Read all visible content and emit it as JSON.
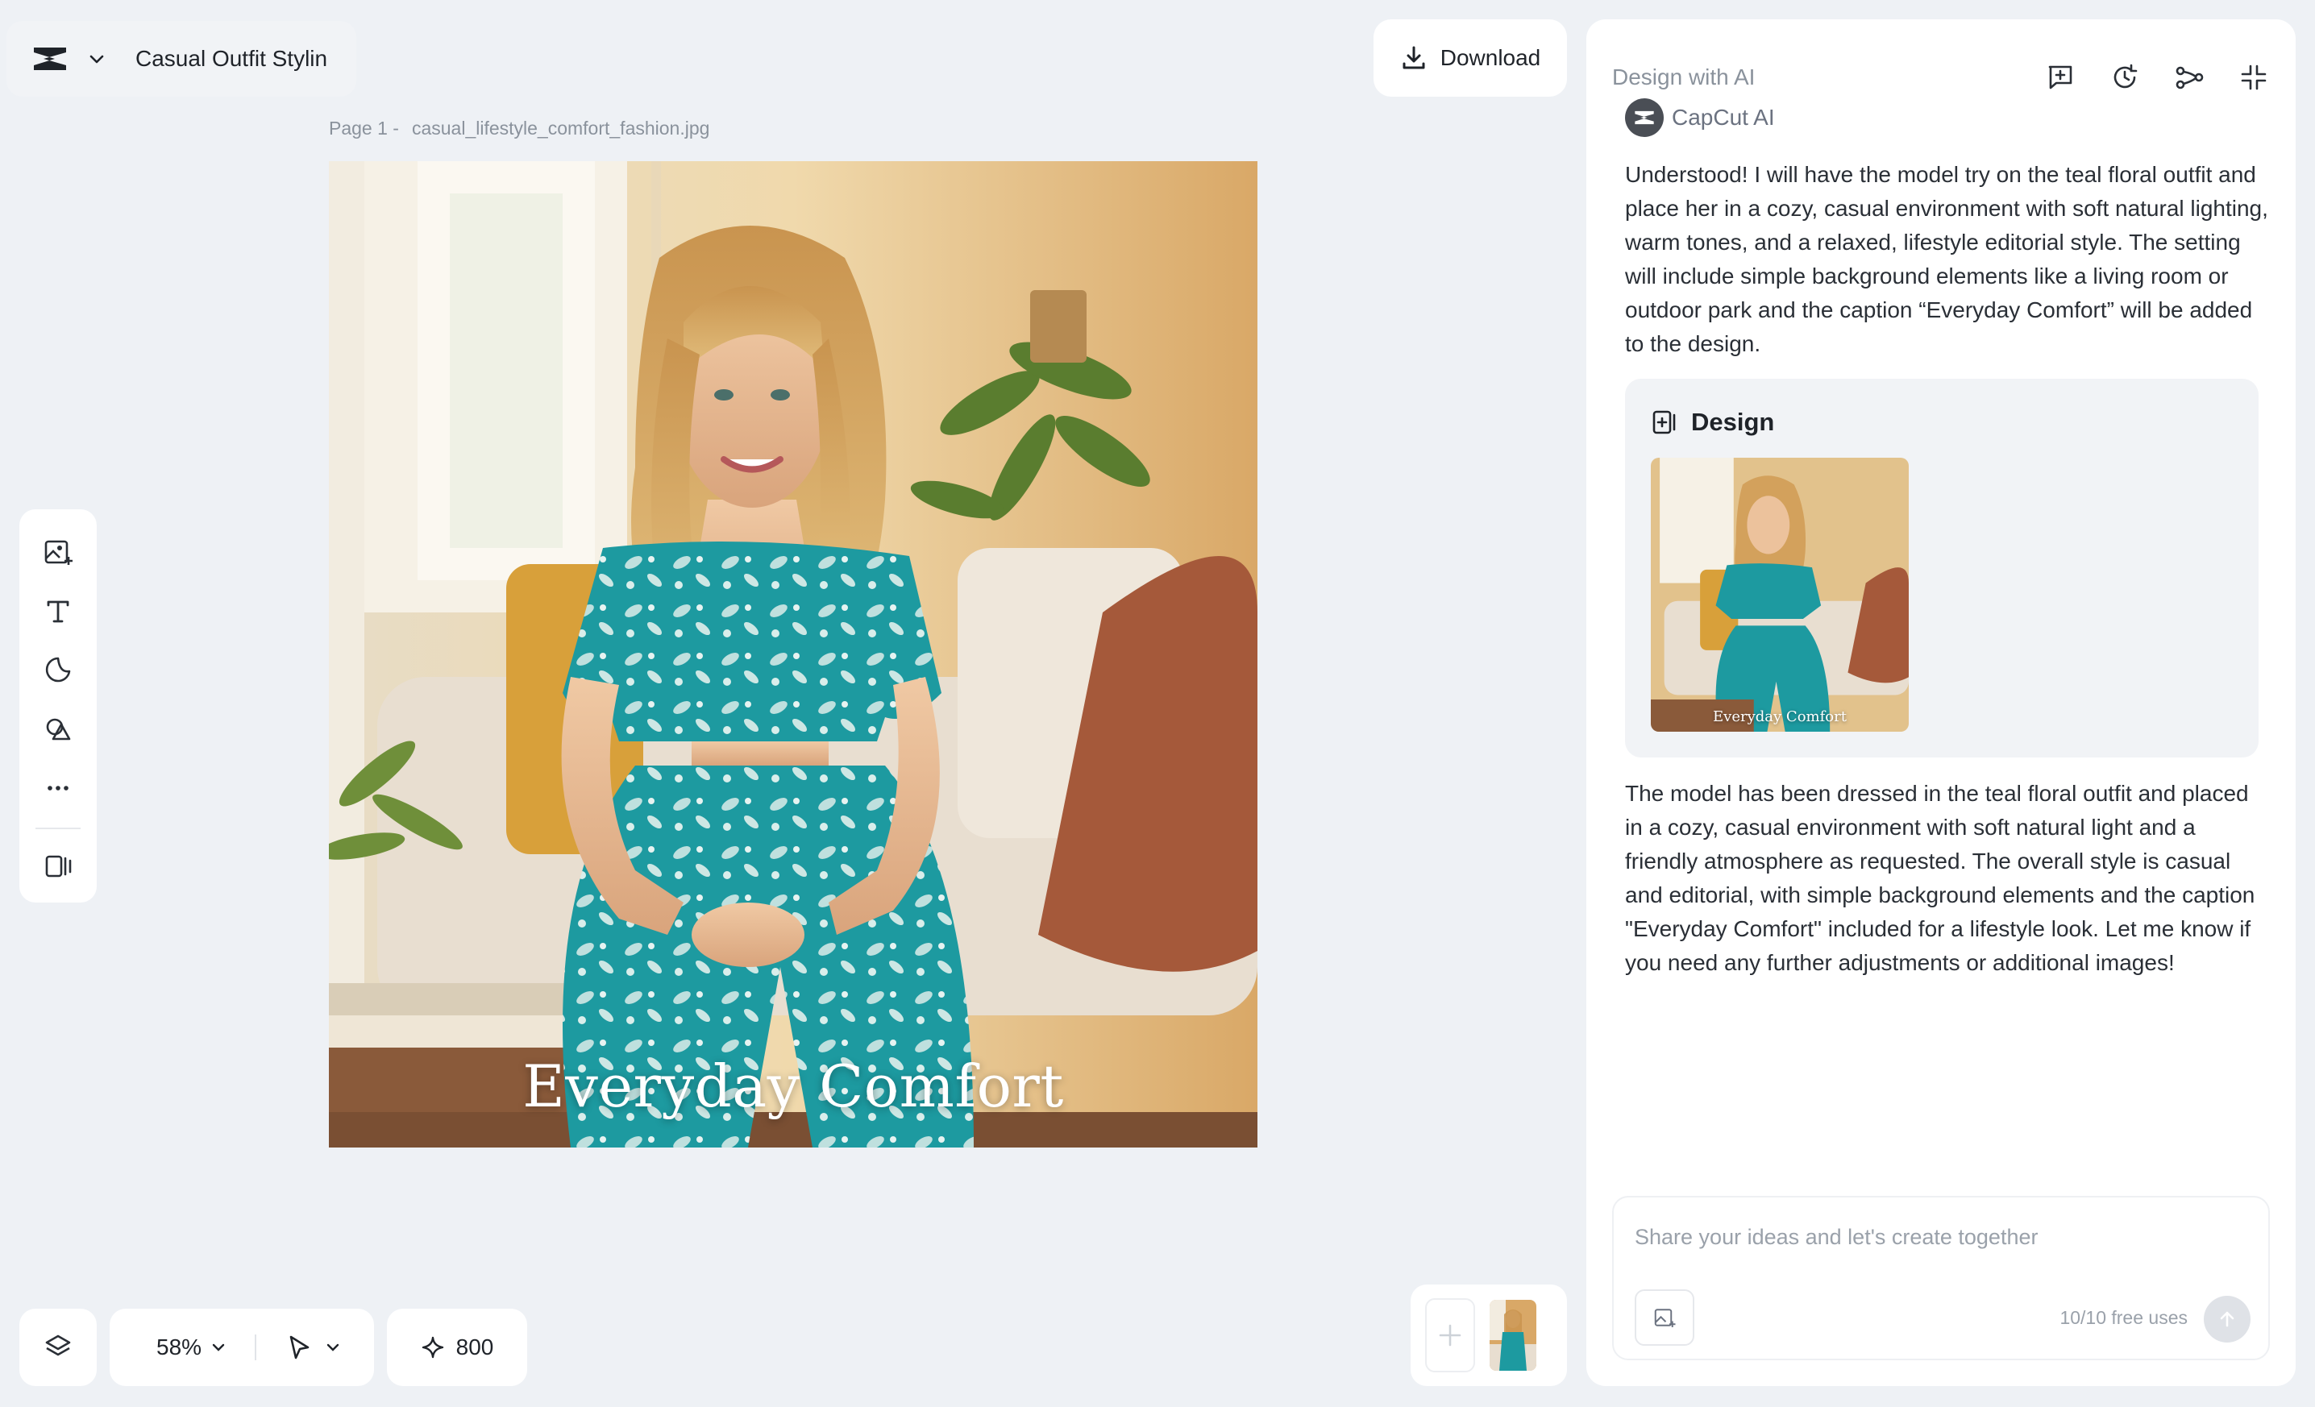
{
  "project": {
    "title": "Casual Outfit Stylin"
  },
  "toolbar": {
    "download_label": "Download"
  },
  "page": {
    "prefix": "Page 1 -",
    "filename": "casual_lifestyle_comfort_fashion.jpg"
  },
  "canvas": {
    "caption": "Everyday Comfort"
  },
  "bottom": {
    "zoom": "58%",
    "credits": "800"
  },
  "ai_panel": {
    "title": "Design with AI",
    "author": "CapCut AI",
    "message1": "Understood! I will have the model try on the teal floral outfit and place her in a cozy, casual environment with soft natural lighting, warm tones, and a relaxed, lifestyle editorial style. The setting will include simple background elements like a living room or outdoor park and the caption “Everyday Comfort” will be added to the design.",
    "design_card_title": "Design",
    "design_thumb_caption": "Everyday Comfort",
    "message2": "The model has been dressed in the teal floral outfit and placed in a cozy, casual environment with soft natural light and a friendly atmosphere as requested. The overall style is casual and editorial, with simple background elements and the caption \"Everyday Comfort\" included for a lifestyle look. Let me know if you need any further adjustments or additional images!",
    "input_placeholder": "Share your ideas and let's create together",
    "free_uses": "10/10 free uses"
  }
}
